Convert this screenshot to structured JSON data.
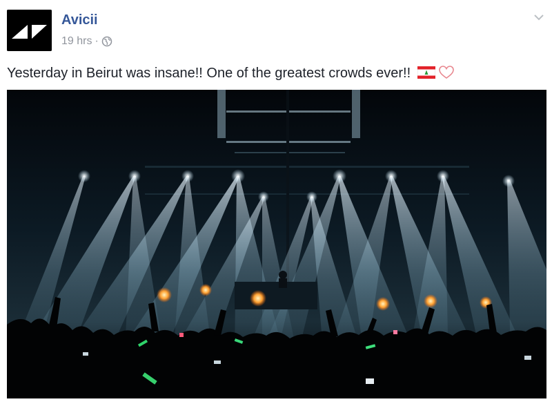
{
  "post": {
    "author": "Avicii",
    "time": "19 hrs",
    "separator": "·",
    "privacy_icon": "globe-icon",
    "options_icon": "chevron-down-icon",
    "message": "Yesterday in Beirut was insane!! One of the greatest crowds ever!!",
    "emojis": [
      "lebanon-flag-emoji",
      "heart-emoji"
    ],
    "photo_subject": "concert-stage-light-beams-crowd",
    "colors": {
      "link": "#365899",
      "meta": "#90949c",
      "text": "#1d2129"
    }
  }
}
